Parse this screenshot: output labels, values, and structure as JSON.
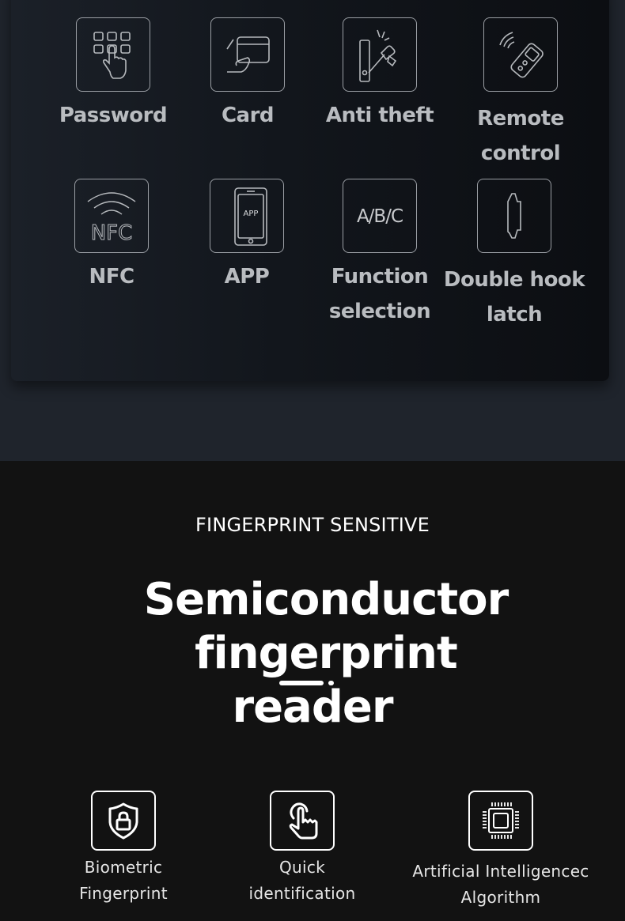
{
  "top_features": [
    {
      "icon": "keypad-touch-icon",
      "label_lines": [
        "Password"
      ]
    },
    {
      "icon": "card-in-hand-icon",
      "label_lines": [
        "Card"
      ]
    },
    {
      "icon": "anti-theft-hammer-icon",
      "label_lines": [
        "Anti theft"
      ]
    },
    {
      "icon": "remote-control-icon",
      "label_lines": [
        "Remote control"
      ]
    },
    {
      "icon": "nfc-icon",
      "label_lines": [
        "NFC"
      ],
      "icon_text": "NFC"
    },
    {
      "icon": "smartphone-app-icon",
      "label_lines": [
        "APP"
      ],
      "icon_text": "APP"
    },
    {
      "icon": "abc-function-icon",
      "label_lines": [
        "Function",
        "selection"
      ],
      "icon_text": "A/B/C"
    },
    {
      "icon": "double-hook-latch-icon",
      "label_lines": [
        "Double hook",
        "latch"
      ]
    }
  ],
  "fingerprint": {
    "eyebrow": "FINGERPRINT SENSITIVE",
    "headline_line1": "Semiconductor fingerprint",
    "headline_line2": "reader"
  },
  "bottom_features": [
    {
      "icon": "shield-lock-icon",
      "label_lines": [
        "Biometric",
        "Fingerprint"
      ]
    },
    {
      "icon": "finger-tap-icon",
      "label_lines": [
        "Quick",
        "identification"
      ]
    },
    {
      "icon": "cpu-chip-icon",
      "label_lines": [
        "Artificial Intelligencec",
        "Algorithm"
      ]
    }
  ],
  "colors": {
    "top_bg": "#1f242c",
    "card_bg": "#12161c",
    "bottom_bg": "#121212",
    "label_gray": "#b9bcc0",
    "white": "#ffffff"
  }
}
